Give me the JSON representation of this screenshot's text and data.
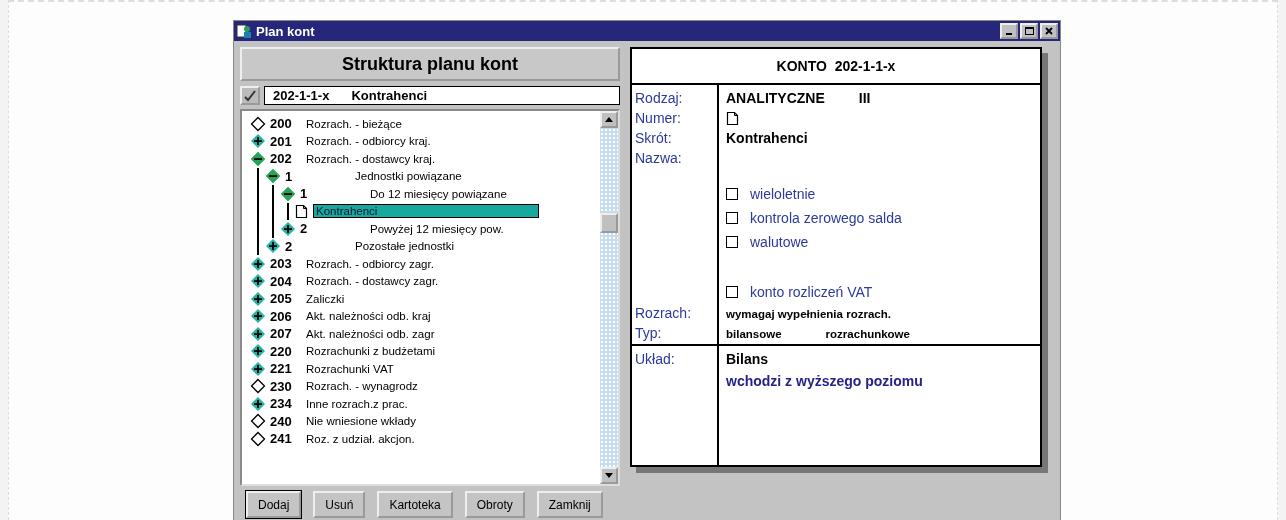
{
  "window": {
    "title": "Plan kont"
  },
  "left": {
    "heading": "Struktura planu kont",
    "path": {
      "code": "202-1-1-x",
      "name": "Kontrahenci"
    },
    "tree": [
      {
        "code": "200",
        "label": "Rozrach. - bieżące",
        "kind": "empty",
        "selected": false
      },
      {
        "code": "201",
        "label": "Rozrach. - odbiorcy kraj.",
        "kind": "group",
        "expanded": false,
        "selected": false
      },
      {
        "code": "202",
        "label": "Rozrach. - dostawcy kraj.",
        "kind": "group",
        "expanded": true,
        "selected": false,
        "children": [
          {
            "code": "1",
            "label": "Jednostki powiązane",
            "kind": "group",
            "expanded": true,
            "selected": false,
            "children": [
              {
                "code": "1",
                "label": "Do 12 miesięcy powiązane",
                "kind": "group",
                "expanded": true,
                "selected": false,
                "children": [
                  {
                    "label": "Kontrahenci",
                    "kind": "document",
                    "selected": true
                  }
                ]
              },
              {
                "code": "2",
                "label": "Powyżej 12 miesięcy pow.",
                "kind": "group",
                "expanded": false,
                "selected": false
              }
            ]
          },
          {
            "code": "2",
            "label": "Pozostałe jednostki",
            "kind": "group",
            "expanded": false,
            "selected": false
          }
        ]
      },
      {
        "code": "203",
        "label": "Rozrach. - odbiorcy zagr.",
        "kind": "group",
        "expanded": false,
        "selected": false
      },
      {
        "code": "204",
        "label": "Rozrach. - dostawcy zagr.",
        "kind": "group",
        "expanded": false,
        "selected": false
      },
      {
        "code": "205",
        "label": "Zaliczki",
        "kind": "group",
        "expanded": false,
        "selected": false
      },
      {
        "code": "206",
        "label": "Akt. należności odb. kraj",
        "kind": "group",
        "expanded": false,
        "selected": false
      },
      {
        "code": "207",
        "label": "Akt. należności odb. zagr",
        "kind": "group",
        "expanded": false,
        "selected": false
      },
      {
        "code": "220",
        "label": "Rozrachunki z budżetami",
        "kind": "group",
        "expanded": false,
        "selected": false
      },
      {
        "code": "221",
        "label": "Rozrachunki VAT",
        "kind": "group",
        "expanded": false,
        "selected": false
      },
      {
        "code": "230",
        "label": "Rozrach. - wynagrodz",
        "kind": "empty",
        "selected": false
      },
      {
        "code": "234",
        "label": "Inne rozrach.z prac.",
        "kind": "group",
        "expanded": false,
        "selected": false
      },
      {
        "code": "240",
        "label": "Nie wniesione wkłady",
        "kind": "empty",
        "selected": false
      },
      {
        "code": "241",
        "label": "Roz. z udział. akcjon.",
        "kind": "empty",
        "selected": false
      }
    ],
    "buttons": [
      {
        "label": "Dodaj",
        "default": true
      },
      {
        "label": "Usuń",
        "default": false
      },
      {
        "label": "Kartoteka",
        "default": false
      },
      {
        "label": "Obroty",
        "default": false
      },
      {
        "label": "Zamknij",
        "default": false
      }
    ]
  },
  "card": {
    "title": "KONTO  202-1-1-x",
    "rodzaj": {
      "label": "Rodzaj:",
      "value": "ANALITYCZNE",
      "level": "III"
    },
    "numer": {
      "label": "Numer:"
    },
    "skrot": {
      "label": "Skrót:",
      "value": "Kontrahenci"
    },
    "nazwa": {
      "label": "Nazwa:"
    },
    "options": [
      {
        "label": "wieloletnie",
        "checked": false
      },
      {
        "label": "kontrola zerowego salda",
        "checked": false
      },
      {
        "label": "walutowe",
        "checked": false
      }
    ],
    "vat": {
      "label": "konto rozliczeń VAT",
      "checked": false
    },
    "rozrach": {
      "label": "Rozrach:",
      "value": "wymagaj wypełnienia rozrach."
    },
    "typ": {
      "label": "Typ:",
      "values": [
        "bilansowe",
        "rozrachunkowe"
      ]
    },
    "uklad": {
      "label": "Układ:",
      "value": "Bilans",
      "note": "wchodzi z wyższego poziomu"
    }
  }
}
